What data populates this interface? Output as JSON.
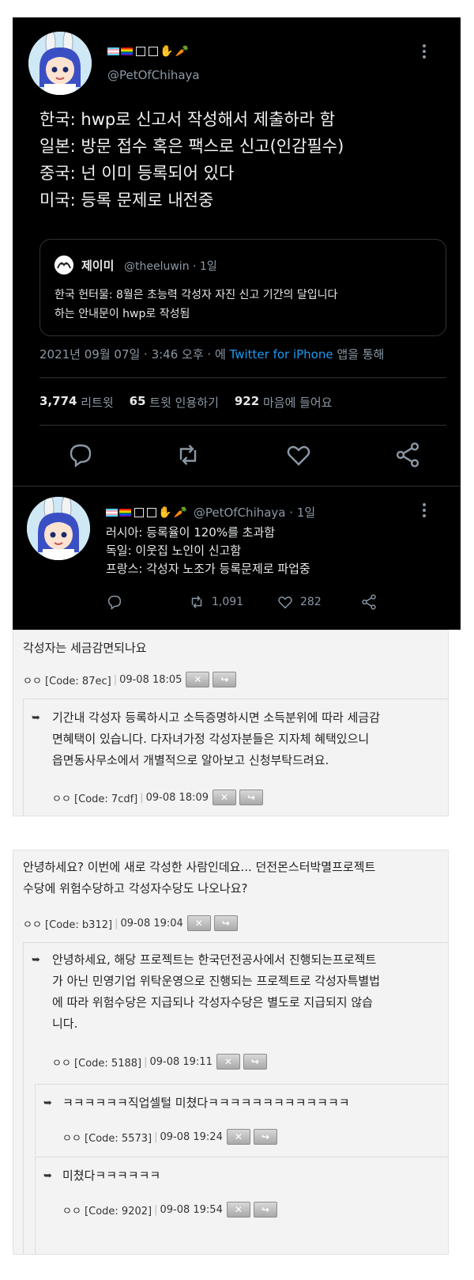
{
  "tweet": {
    "handle": "@PetOfChihaya",
    "lines": [
      "한국: hwp로 신고서 작성해서 제출하라 함",
      "일본: 방문 접수 혹은 팩스로 신고(인감필수)",
      "중국: 넌 이미 등록되어 있다",
      "미국: 등록 문제로 내전중"
    ],
    "quote": {
      "name": "제이미",
      "meta": "@theeluwin · 1일",
      "line1": "한국 헌터물: 8월은 초능력 각성자 자진 신고 기간의 달입니다",
      "line2": "하는 안내문이 hwp로 작성됨"
    },
    "timestamp": "2021년 09월 07일 · 3:46 오후 · 에",
    "app": "Twitter for iPhone",
    "via": "앱을 통해",
    "retweets": "3,774",
    "retweets_label": "리트윗",
    "quotes": "65",
    "quotes_label": "트윗 인용하기",
    "likes": "922",
    "likes_label": "마음에 들어요"
  },
  "reply": {
    "meta": "@PetOfChihaya · 1일",
    "lines": [
      "러시아: 등록율이 120%를 초과함",
      "독일: 이웃집 노인이 신고함",
      "프랑스: 각성자 노조가 등록문제로 파업중"
    ],
    "retweets": "1,091",
    "likes": "282"
  },
  "board1": {
    "question": "각성자는 세금감면되나요",
    "q_author": "ㅇㅇ [Code: 87ec]",
    "q_date": "09-08 18:05",
    "answer_lines": [
      "기간내 각성자 등록하시고 소득증명하시면 소득분위에 따라 세금감",
      "면혜택이 있습니다. 다자녀가정 각성자분들은 지자체 혜택있으니",
      "읍면동사무소에서 개별적으로 알아보고 신청부탁드려요."
    ],
    "a_author": "ㅇㅇ [Code: 7cdf]",
    "a_date": "09-08 18:09"
  },
  "board2": {
    "question_lines": [
      "안녕하세요? 이번에 새로 각성한 사람인데요... 던전몬스터박멸프로젝트",
      "수당에 위험수당하고 각성자수당도 나오나요?"
    ],
    "q_author": "ㅇㅇ [Code: b312]",
    "q_date": "09-08 19:04",
    "answer_lines": [
      "안녕하세요, 해당 프로젝트는 한국던전공사에서 진행되는프로젝트",
      "가 아닌 민영기업 위탁운영으로 진행되는 프로젝트로 각성자특별법",
      "에 따라 위험수당은 지급되나 각성자수당은 별도로 지급되지 않습",
      "니다."
    ],
    "a_author": "ㅇㅇ [Code: 5188]",
    "a_date": "09-08 19:11",
    "reply1": "ㅋㅋㅋㅋㅋㅋ직업셀털 미쳤다ㅋㅋㅋㅋㅋㅋㅋㅋㅋㅋㅋㅋㅋ",
    "r1_author": "ㅇㅇ [Code: 5573]",
    "r1_date": "09-08 19:24",
    "reply2": "미쳤다ㅋㅋㅋㅋㅋㅋ",
    "r2_author": "ㅇㅇ [Code: 9202]",
    "r2_date": "09-08 19:54"
  },
  "buttons": {
    "delete": "✕",
    "reply": "↪"
  },
  "reply_arrow": "➥"
}
